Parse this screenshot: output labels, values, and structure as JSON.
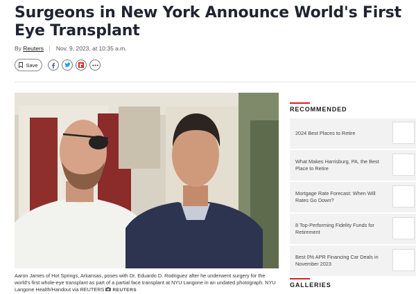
{
  "article": {
    "title": "Surgeons in New York Announce World's First Eye Transplant",
    "byline_prefix": "By",
    "author": "Reuters",
    "date": "Nov. 9, 2023, at 10:35 a.m."
  },
  "actions": {
    "save_label": "Save",
    "share_icons": [
      "facebook-icon",
      "twitter-icon",
      "flipboard-icon",
      "more-icon"
    ]
  },
  "photo": {
    "caption": "Aaron James of Hot Springs, Arkansas, poses with Dr. Eduardo D. Rodriguez after he underwent surgery for the world's first whole-eye transplant as part of a partial face transplant at NYU Langone in an undated photograph. NYU Langone Health/Handout via REUTERS",
    "credit": "REUTERS"
  },
  "sidebar": {
    "recommended_title": "RECOMMENDED",
    "items": [
      {
        "label": "2024 Best Places to Retire"
      },
      {
        "label": "What Makes Harrisburg, PA, the Best Place to Retire"
      },
      {
        "label": "Mortgage Rate Forecast: When Will Rates Go Down?"
      },
      {
        "label": "8 Top-Performing Fidelity Funds for Retirement"
      },
      {
        "label": "Best 0% APR Financing Car Deals in November 2023"
      }
    ],
    "galleries_title": "GALLERIES"
  },
  "colors": {
    "accent": "#d61f26",
    "facebook": "#3b5998",
    "twitter": "#1da1f2",
    "flipboard": "#e12828"
  }
}
